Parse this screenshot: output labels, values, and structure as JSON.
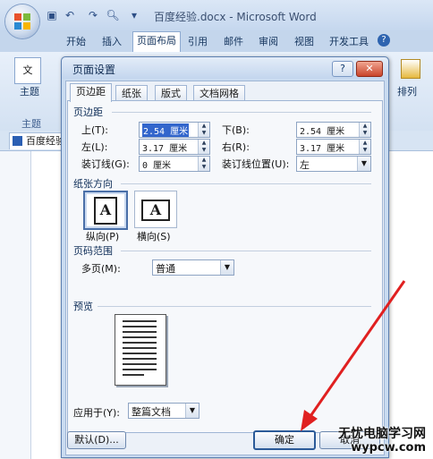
{
  "window": {
    "doc_title": "百度经验.docx - Microsoft Word",
    "qat_icons": [
      "save-icon",
      "undo-icon",
      "redo-icon",
      "print-preview-icon",
      "dropdown-icon"
    ]
  },
  "ribbon": {
    "tabs": [
      "开始",
      "插入",
      "页面布局",
      "引用",
      "邮件",
      "审阅",
      "视图",
      "开发工具"
    ],
    "active_tab": "页面布局",
    "theme_label": "主题",
    "theme_group_label": "主题",
    "arrange_label": "排列"
  },
  "doc_tab": {
    "label": "百度经验"
  },
  "dialog": {
    "title": "页面设置",
    "help": "?",
    "tabs": [
      "页边距",
      "纸张",
      "版式",
      "文档网格"
    ],
    "active_tab": "页边距",
    "margins": {
      "section": "页边距",
      "top": {
        "label": "上(T):",
        "value": "2.54 厘米"
      },
      "bottom": {
        "label": "下(B):",
        "value": "2.54 厘米"
      },
      "left": {
        "label": "左(L):",
        "value": "3.17 厘米"
      },
      "right": {
        "label": "右(R):",
        "value": "3.17 厘米"
      },
      "gutter": {
        "label": "装订线(G):",
        "value": "0 厘米"
      },
      "gutter_pos": {
        "label": "装订线位置(U):",
        "value": "左"
      }
    },
    "orientation": {
      "section": "纸张方向",
      "portrait": "纵向(P)",
      "landscape": "横向(S)",
      "selected": "纵向(P)"
    },
    "pages": {
      "section": "页码范围",
      "multiple_label": "多页(M):",
      "multiple_value": "普通"
    },
    "preview": {
      "section": "预览"
    },
    "apply": {
      "label": "应用于(Y):",
      "value": "整篇文档"
    },
    "buttons": {
      "default": "默认(D)...",
      "ok": "确定",
      "cancel": "取消"
    }
  },
  "watermark": {
    "line1": "无忧电脑学习网",
    "line2": "wypcw.com"
  },
  "colors": {
    "arrow": "#e02020",
    "ribbon": "#c4d6ec",
    "dialog_bg": "#ecf1f8"
  }
}
